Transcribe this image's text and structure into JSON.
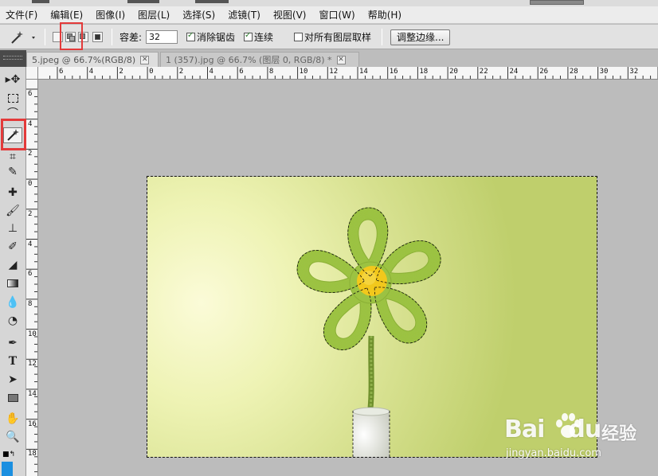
{
  "menu": [
    "文件(F)",
    "编辑(E)",
    "图像(I)",
    "图层(L)",
    "选择(S)",
    "滤镜(T)",
    "视图(V)",
    "窗口(W)",
    "帮助(H)"
  ],
  "options": {
    "tolerance_label": "容差:",
    "tolerance_value": "32",
    "antialias_label": "消除锯齿",
    "antialias_checked": true,
    "contiguous_label": "连续",
    "contiguous_checked": true,
    "sample_all_label": "对所有图层取样",
    "sample_all_checked": false,
    "refine_edge_label": "调整边缘..."
  },
  "tabs": [
    {
      "label": "5.jpeg @ 66.7%(RGB/8)",
      "active": true
    },
    {
      "label": "1 (357).jpg @ 66.7% (图层 0, RGB/8) *",
      "active": false
    }
  ],
  "ruler": {
    "h_labels": [
      "6",
      "4",
      "2",
      "0",
      "2",
      "4",
      "6",
      "8",
      "10",
      "12",
      "14",
      "16",
      "18",
      "20",
      "22",
      "24",
      "26",
      "28",
      "30",
      "32"
    ],
    "v_labels": [
      "6",
      "4",
      "2",
      "0",
      "2",
      "4",
      "6",
      "8",
      "10",
      "12",
      "14",
      "16",
      "18"
    ]
  },
  "toolbox": {
    "tools": [
      "move-tool",
      "marquee-tool",
      "lasso-tool",
      "magic-wand-tool",
      "crop-tool",
      "eyedropper-tool",
      "healing-brush-tool",
      "brush-tool",
      "clone-stamp-tool",
      "history-brush-tool",
      "eraser-tool",
      "gradient-tool",
      "blur-tool",
      "dodge-tool",
      "pen-tool",
      "type-tool",
      "path-selection-tool",
      "shape-tool",
      "hand-tool",
      "zoom-tool"
    ],
    "active_tool": "magic-wand-tool",
    "foreground_color": "#1b8fe0"
  },
  "watermark": {
    "brand": "Bai",
    "brand2": "du",
    "cn": "经验",
    "url": "jingyan.baidu.com"
  },
  "colors": {
    "highlight": "#e33a3a",
    "felt_green": "#9bc43c",
    "center_yellow": "#f2c81c"
  }
}
